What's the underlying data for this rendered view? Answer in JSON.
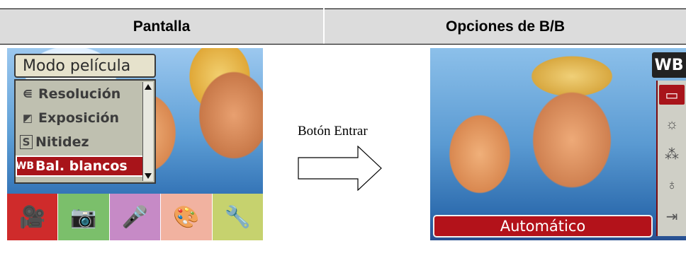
{
  "headers": {
    "left": "Pantalla",
    "right": "Opciones de B/B"
  },
  "left_screen": {
    "menu_title": "Modo película",
    "menu_items": [
      {
        "icon": "resolution-icon",
        "glyph": "⋹",
        "label": "Resolución"
      },
      {
        "icon": "exposure-icon",
        "glyph": "◩",
        "label": "Exposición"
      },
      {
        "icon": "sharpness-icon",
        "glyph": "S",
        "label": "Nitidez"
      },
      {
        "icon": "white-balance-icon",
        "glyph": "WB",
        "label": "Bal. blancos"
      }
    ],
    "tabs": [
      {
        "icon": "movie-mode-icon",
        "glyph": "🎥"
      },
      {
        "icon": "camera-mode-icon",
        "glyph": "📷"
      },
      {
        "icon": "voice-mode-icon",
        "glyph": "🎤"
      },
      {
        "icon": "effects-icon",
        "glyph": "🎨"
      },
      {
        "icon": "setup-icon",
        "glyph": "🔧"
      }
    ]
  },
  "arrow": {
    "label": "Botón Entrar"
  },
  "right_screen": {
    "badge": "WB",
    "options": [
      {
        "icon": "auto-wb-icon",
        "glyph": "▭"
      },
      {
        "icon": "daylight-icon",
        "glyph": "☼"
      },
      {
        "icon": "fluorescent-icon",
        "glyph": "⁂"
      },
      {
        "icon": "tungsten-icon",
        "glyph": "♁"
      },
      {
        "icon": "exit-icon",
        "glyph": "⇥"
      }
    ],
    "status": "Automático"
  }
}
